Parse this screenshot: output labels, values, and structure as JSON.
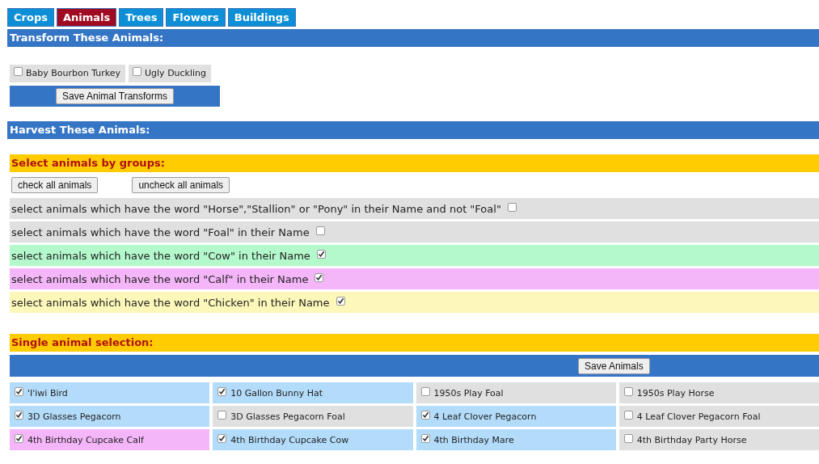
{
  "tabs": [
    {
      "label": "Crops",
      "selected": false
    },
    {
      "label": "Animals",
      "selected": true
    },
    {
      "label": "Trees",
      "selected": false
    },
    {
      "label": "Flowers",
      "selected": false
    },
    {
      "label": "Buildings",
      "selected": false
    }
  ],
  "transform": {
    "heading": "Transform These Animals:",
    "items": [
      {
        "label": "Baby Bourbon Turkey",
        "checked": false
      },
      {
        "label": "Ugly Duckling",
        "checked": false
      }
    ],
    "save_button": "Save Animal Transforms"
  },
  "harvest": {
    "heading": "Harvest These Animals:"
  },
  "groups": {
    "heading": "Select animals by groups:",
    "buttons": [
      "check all animals",
      "uncheck all animals"
    ],
    "rows": [
      {
        "label": "select animals which have the word \"Horse\",\"Stallion\" or \"Pony\" in their Name and not \"Foal\"",
        "checked": false,
        "color": "#e0e0e0"
      },
      {
        "label": "select animals which have the word \"Foal\" in their Name",
        "checked": false,
        "color": "#e0e0e0"
      },
      {
        "label": "select animals which have the word \"Cow\" in their Name",
        "checked": true,
        "color": "#b3f9cc"
      },
      {
        "label": "select animals which have the word \"Calf\" in their Name",
        "checked": true,
        "color": "#f4b6f9"
      },
      {
        "label": "select animals which have the word \"Chicken\" in their Name",
        "checked": true,
        "color": "#fdf8b9"
      }
    ]
  },
  "single": {
    "heading": "Single animal selection:",
    "save_button": "Save Animals",
    "animals": [
      {
        "label": "'I'iwi Bird",
        "checked": true,
        "color": "#b3dcfb"
      },
      {
        "label": "10 Gallon Bunny Hat",
        "checked": true,
        "color": "#b3dcfb"
      },
      {
        "label": "1950s Play Foal",
        "checked": false,
        "color": "#e0e0e0"
      },
      {
        "label": "1950s Play Horse",
        "checked": false,
        "color": "#e0e0e0"
      },
      {
        "label": "3D Glasses Pegacorn",
        "checked": true,
        "color": "#b3dcfb"
      },
      {
        "label": "3D Glasses Pegacorn Foal",
        "checked": false,
        "color": "#e0e0e0"
      },
      {
        "label": "4 Leaf Clover Pegacorn",
        "checked": true,
        "color": "#b3dcfb"
      },
      {
        "label": "4 Leaf Clover Pegacorn Foal",
        "checked": false,
        "color": "#e0e0e0"
      },
      {
        "label": "4th Birthday Cupcake Calf",
        "checked": true,
        "color": "#f4b6f9"
      },
      {
        "label": "4th Birthday Cupcake Cow",
        "checked": true,
        "color": "#b3dcfb"
      },
      {
        "label": "4th Birthday Mare",
        "checked": true,
        "color": "#b3dcfb"
      },
      {
        "label": "4th Birthday Party Horse",
        "checked": false,
        "color": "#e0e0e0"
      }
    ]
  }
}
